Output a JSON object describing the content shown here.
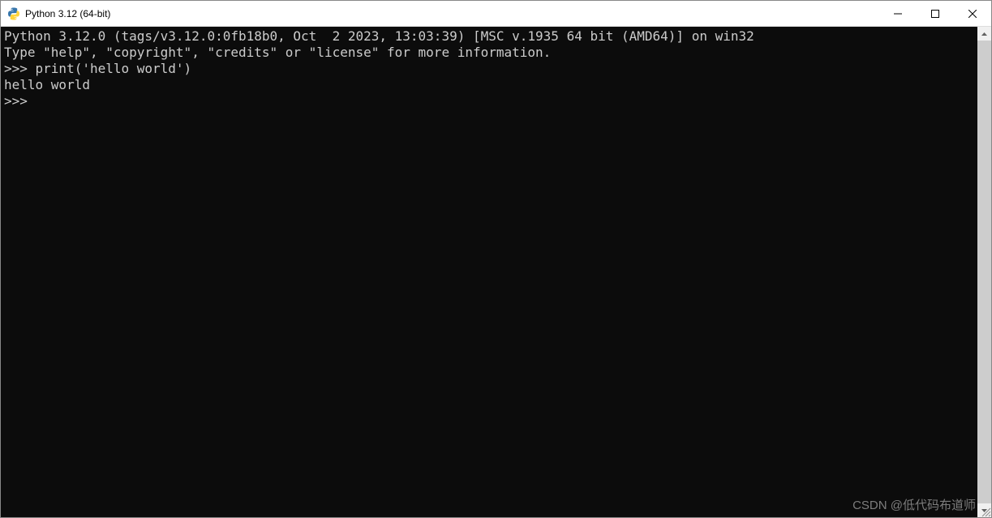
{
  "window": {
    "title": "Python 3.12 (64-bit)"
  },
  "terminal": {
    "lines": [
      "Python 3.12.0 (tags/v3.12.0:0fb18b0, Oct  2 2023, 13:03:39) [MSC v.1935 64 bit (AMD64)] on win32",
      "Type \"help\", \"copyright\", \"credits\" or \"license\" for more information.",
      ">>> print('hello world')",
      "hello world",
      ">>> "
    ]
  },
  "watermark": "CSDN @低代码布道师"
}
